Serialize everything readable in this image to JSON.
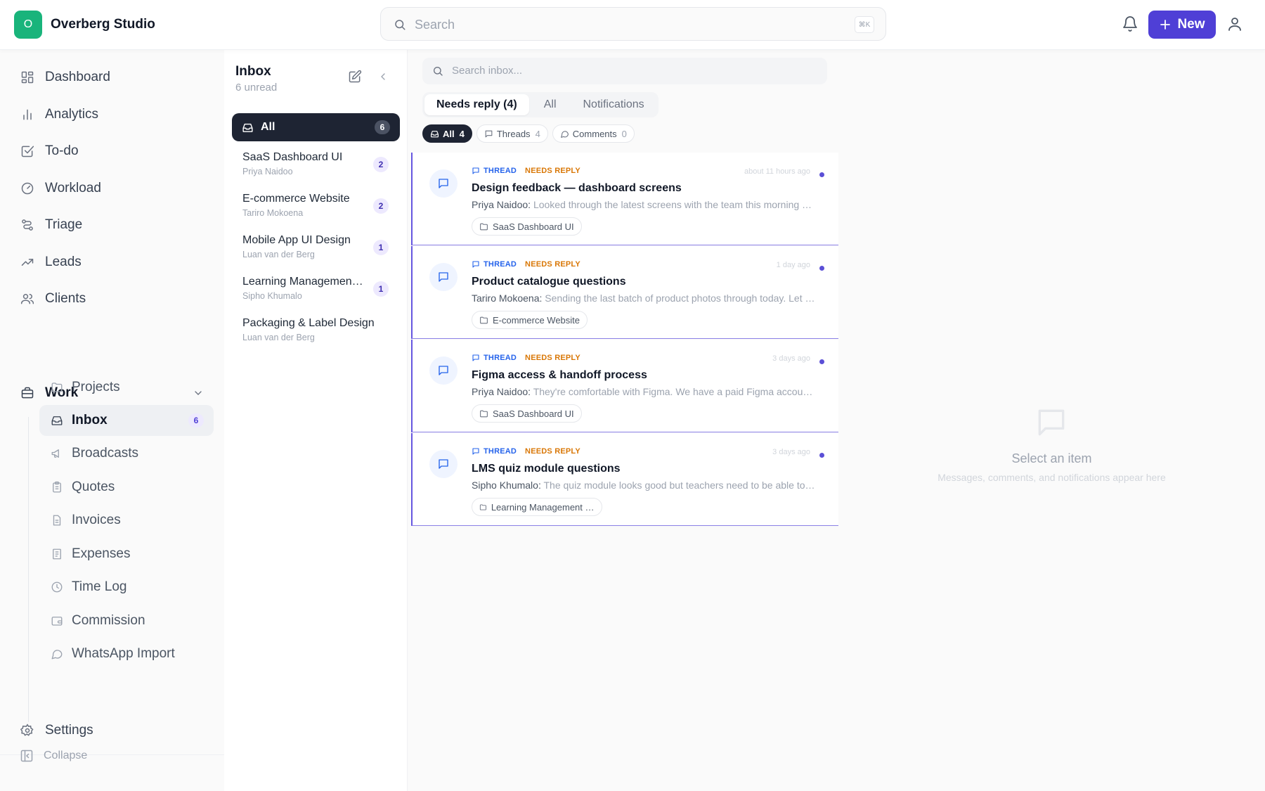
{
  "brand": {
    "initial": "O",
    "name": "Overberg Studio"
  },
  "topbar": {
    "search_placeholder": "Search",
    "shortcut": "⌘K",
    "new_label": "New"
  },
  "sidebar": {
    "items": [
      {
        "label": "Dashboard",
        "icon": "grid-icon"
      },
      {
        "label": "Analytics",
        "icon": "bar-chart-icon"
      },
      {
        "label": "To-do",
        "icon": "checkbox-icon"
      },
      {
        "label": "Workload",
        "icon": "gauge-icon"
      },
      {
        "label": "Triage",
        "icon": "triage-icon"
      },
      {
        "label": "Leads",
        "icon": "trending-up-icon"
      },
      {
        "label": "Clients",
        "icon": "users-icon"
      }
    ],
    "work_label": "Work",
    "work_items": [
      {
        "label": "Projects",
        "icon": "folder-icon"
      },
      {
        "label": "Inbox",
        "icon": "inbox-icon",
        "badge": "6",
        "active": true
      },
      {
        "label": "Broadcasts",
        "icon": "megaphone-icon"
      },
      {
        "label": "Quotes",
        "icon": "clipboard-icon"
      },
      {
        "label": "Invoices",
        "icon": "file-icon"
      },
      {
        "label": "Expenses",
        "icon": "receipt-icon"
      },
      {
        "label": "Time Log",
        "icon": "clock-icon"
      },
      {
        "label": "Commission",
        "icon": "wallet-icon"
      },
      {
        "label": "WhatsApp Import",
        "icon": "chat-icon"
      }
    ],
    "settings_label": "Settings",
    "collapse_label": "Collapse"
  },
  "inbox": {
    "title": "Inbox",
    "subtitle": "6 unread",
    "all_label": "All",
    "all_count": "6",
    "projects": [
      {
        "name": "SaaS Dashboard UI",
        "owner": "Priya Naidoo",
        "count": "2"
      },
      {
        "name": "E-commerce Website",
        "owner": "Tariro Mokoena",
        "count": "2"
      },
      {
        "name": "Mobile App UI Design",
        "owner": "Luan van der Berg",
        "count": "1"
      },
      {
        "name": "Learning Management System",
        "owner": "Sipho Khumalo",
        "count": "1"
      },
      {
        "name": "Packaging & Label Design",
        "owner": "Luan van der Berg",
        "count": ""
      }
    ]
  },
  "messages": {
    "search_placeholder": "Search inbox...",
    "tabs": [
      "Needs reply (4)",
      "All",
      "Notifications"
    ],
    "chips": [
      {
        "label": "All",
        "count": "4"
      },
      {
        "label": "Threads",
        "count": "4"
      },
      {
        "label": "Comments",
        "count": "0"
      }
    ],
    "items": [
      {
        "type": "THREAD",
        "status": "NEEDS REPLY",
        "time": "about 11 hours ago",
        "subject": "Design feedback — dashboard screens",
        "sender": "Priya Naidoo:",
        "preview": "Looked through the latest screens with the team this morning and we have a few notes",
        "tag": "SaaS Dashboard UI"
      },
      {
        "type": "THREAD",
        "status": "NEEDS REPLY",
        "time": "1 day ago",
        "subject": "Product catalogue questions",
        "sender": "Tariro Mokoena:",
        "preview": "Sending the last batch of product photos through today. Let me know if anything is missing",
        "tag": "E-commerce Website"
      },
      {
        "type": "THREAD",
        "status": "NEEDS REPLY",
        "time": "3 days ago",
        "subject": "Figma access & handoff process",
        "sender": "Priya Naidoo:",
        "preview": "They're comfortable with Figma. We have a paid Figma account for the whole team",
        "tag": "SaaS Dashboard UI"
      },
      {
        "type": "THREAD",
        "status": "NEEDS REPLY",
        "time": "3 days ago",
        "subject": "LMS quiz module questions",
        "sender": "Sipho Khumalo:",
        "preview": "The quiz module looks good but teachers need to be able to set time limits",
        "tag": "Learning Management System"
      }
    ]
  },
  "detail": {
    "empty_title": "Select an item",
    "empty_sub": "Messages, comments, and notifications appear here"
  }
}
